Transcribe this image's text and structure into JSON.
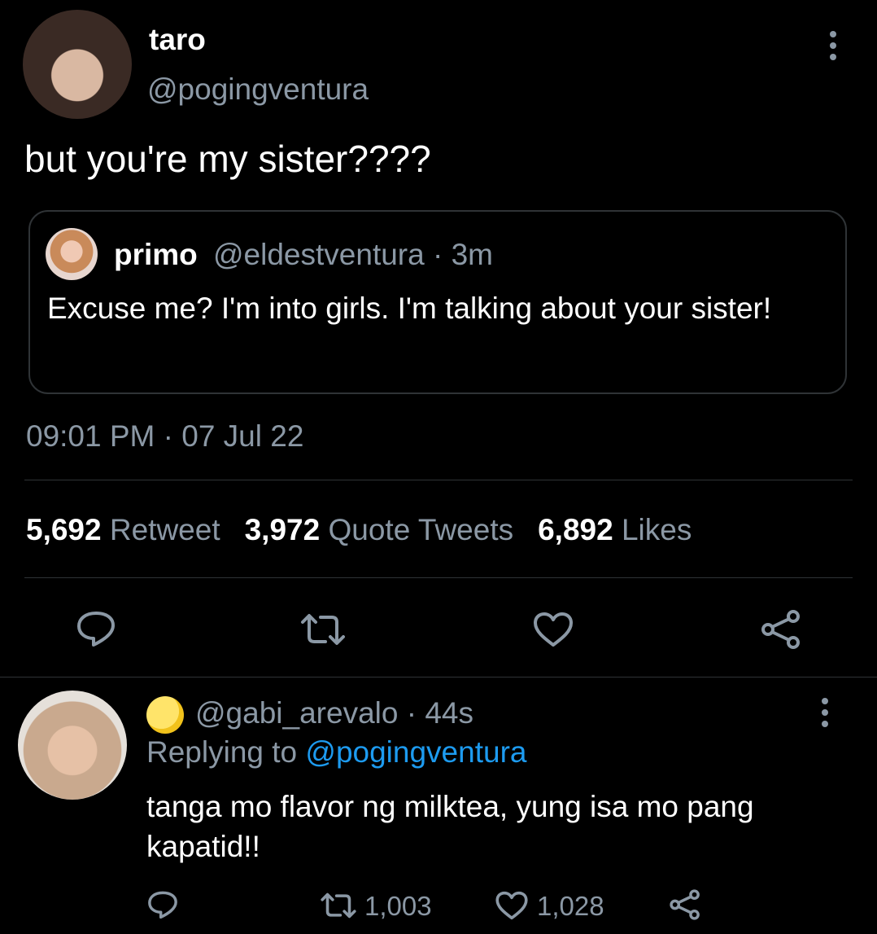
{
  "tweet": {
    "display_name": "taro",
    "handle": "@pogingventura",
    "text": "but you're my sister????",
    "timestamp": "09:01 PM · 07 Jul 22",
    "quote": {
      "name": "primo",
      "handle": "@eldestventura · 3m",
      "text": "Excuse me? I'm into girls. I'm talking about your sister!"
    },
    "stats": {
      "retweets_count": "5,692",
      "retweets_label": "Retweet",
      "quotes_count": "3,972",
      "quotes_label": "Quote Tweets",
      "likes_count": "6,892",
      "likes_label": "Likes"
    },
    "actions": [
      "reply-icon",
      "retweet-icon",
      "like-icon",
      "share-icon"
    ]
  },
  "reply": {
    "handle": "@gabi_arevalo · 44s",
    "replying_prefix": "Replying to",
    "replying_to": "@pogingventura",
    "text": "tanga mo flavor ng milktea, yung isa mo pang kapatid!!",
    "retweets": "1,003",
    "likes": "1,028"
  },
  "colors": {
    "background": "#000000",
    "text_primary": "#ffffff",
    "text_secondary": "#8b98a5",
    "link": "#1d9bf0",
    "border": "#2f3336"
  }
}
